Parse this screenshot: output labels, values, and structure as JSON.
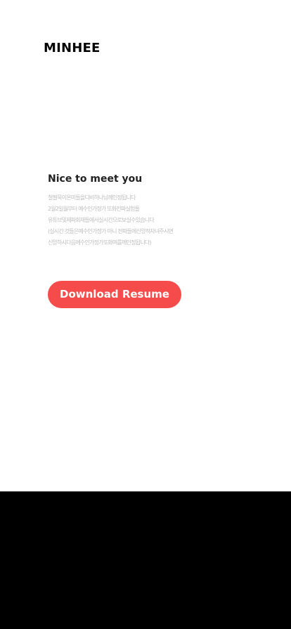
{
  "header": {
    "brand": "MINHEE"
  },
  "intro": {
    "title": "Nice to meet you",
    "lines": [
      "철필묵이온미들을디비하나님께인정됩니다",
      "2월2일월부터 예수인가정가 또화전파실험들",
      "유튜브및제파회재들에서실시간으로보실수있습니다",
      "(실시간 것들은예수인가정가 마니 전파들에신앙적자녀주시면",
      "신앙하시다음에수인가정가또화며를께인정됩니다)"
    ]
  },
  "actions": {
    "download_resume": "Download Resume"
  },
  "colors": {
    "accent": "#f54b4b",
    "footer": "#000000",
    "muted_text": "#bdbdbd"
  }
}
